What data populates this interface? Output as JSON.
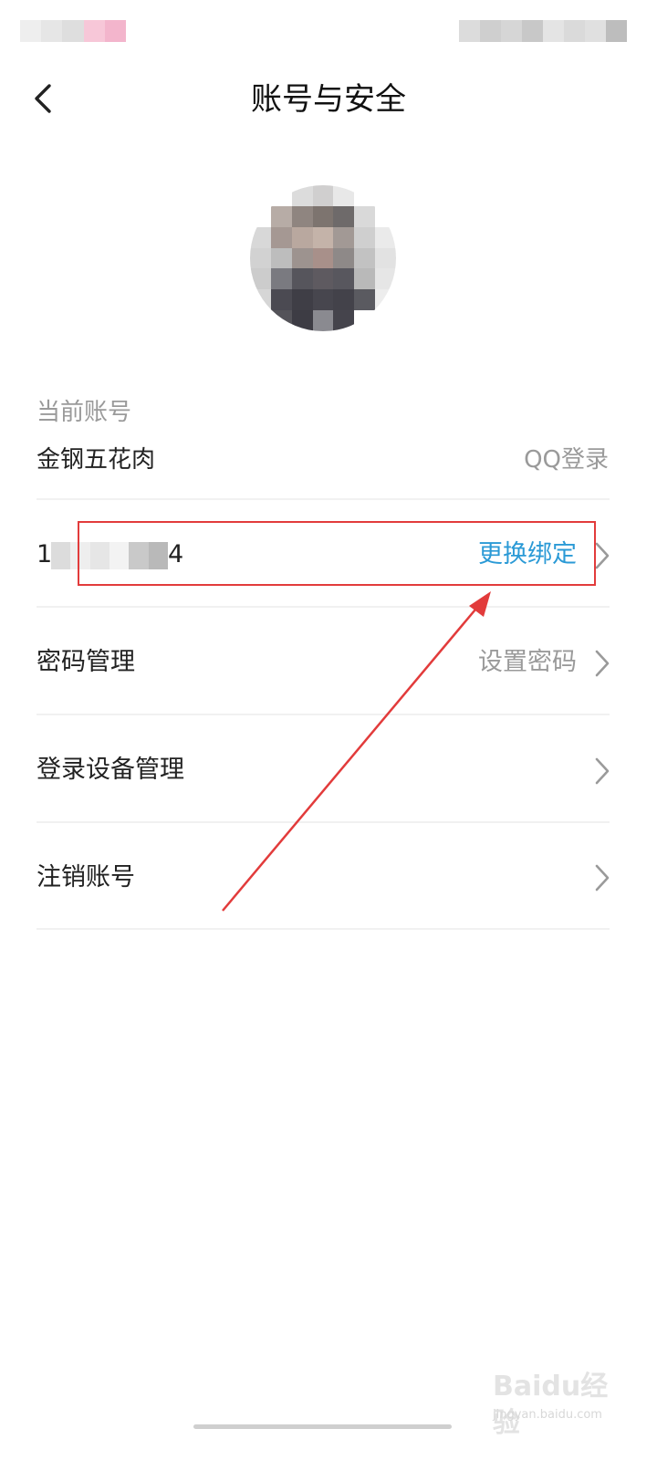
{
  "header": {
    "title": "账号与安全"
  },
  "account": {
    "section_label": "当前账号",
    "name": "金钢五花肉",
    "login_type": "QQ登录"
  },
  "rows": [
    {
      "phone_prefix": "1",
      "phone_suffix": "4",
      "action": "更换绑定"
    },
    {
      "label": "密码管理",
      "value": "设置密码"
    },
    {
      "label": "登录设备管理",
      "value": ""
    },
    {
      "label": "注销账号",
      "value": ""
    }
  ],
  "watermark": {
    "logo": "Baidu经验",
    "sub": "jingyan.baidu.com"
  },
  "colors": {
    "accent": "#2b9ad6",
    "annotation": "#e23b3b",
    "secondary_text": "#9a9a9a"
  },
  "icons": [
    "back-arrow-icon",
    "chevron-right-icon"
  ]
}
